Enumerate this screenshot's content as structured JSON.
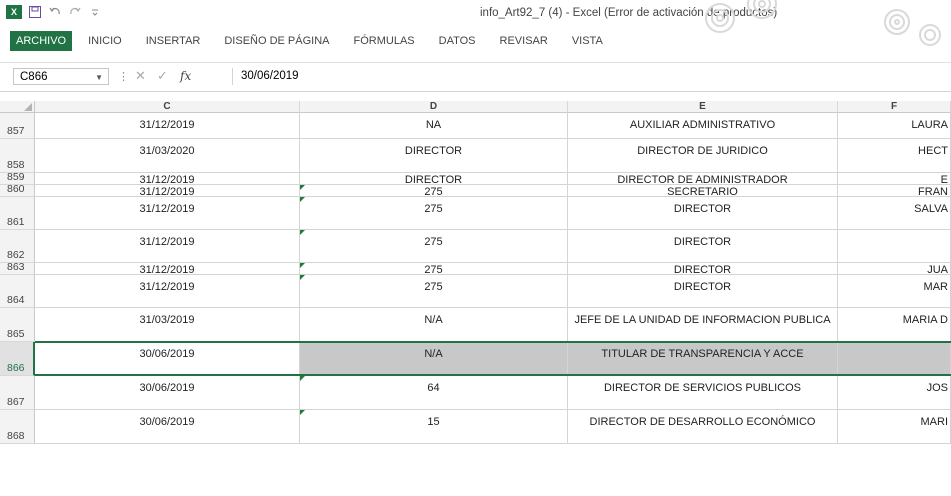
{
  "window": {
    "title": "info_Art92_7 (4) - Excel (Error de activación de productos)",
    "app_icon": "excel-logo-icon",
    "quick_access": [
      "save-icon",
      "undo-icon",
      "redo-icon",
      "customize-icon"
    ]
  },
  "ribbon": {
    "tabs": [
      "ARCHIVO",
      "INICIO",
      "INSERTAR",
      "DISEÑO DE PÁGINA",
      "FÓRMULAS",
      "DATOS",
      "REVISAR",
      "VISTA"
    ],
    "active_tab": "ARCHIVO"
  },
  "formula_bar": {
    "name_box": "C866",
    "fx_label": "fx",
    "value": "30/06/2019"
  },
  "grid": {
    "columns": [
      "C",
      "D",
      "E",
      "F"
    ],
    "rows": [
      {
        "num": "857",
        "c": "31/12/2019",
        "d": "NA",
        "e": "AUXILIAR ADMINISTRATIVO",
        "f": "LAURA"
      },
      {
        "num": "858",
        "c": "31/03/2020",
        "d": "DIRECTOR",
        "e": "DIRECTOR DE JURIDICO",
        "f": "HECT"
      },
      {
        "num": "859",
        "c": "31/12/2019",
        "d": "DIRECTOR",
        "e": "DIRECTOR DE ADMINISTRADOR",
        "f": "E"
      },
      {
        "num": "860",
        "c": "31/12/2019",
        "d": "275",
        "e": "SECRETARIO",
        "f": "FRAN"
      },
      {
        "num": "861",
        "c": "31/12/2019",
        "d": "275",
        "e": "DIRECTOR",
        "f": "SALVA"
      },
      {
        "num": "862",
        "c": "31/12/2019",
        "d": "275",
        "e": "DIRECTOR",
        "f": ""
      },
      {
        "num": "863",
        "c": "31/12/2019",
        "d": "275",
        "e": "DIRECTOR",
        "f": "JUA"
      },
      {
        "num": "864",
        "c": "31/12/2019",
        "d": "275",
        "e": "DIRECTOR",
        "f": "MAR"
      },
      {
        "num": "865",
        "c": "31/03/2019",
        "d": "N/A",
        "e": "JEFE DE LA UNIDAD DE INFORMACION PUBLICA",
        "f": "MARIA D"
      },
      {
        "num": "866",
        "c": "30/06/2019",
        "d": "N/A",
        "e": "TITULAR DE TRANSPARENCIA Y ACCE",
        "f": ""
      },
      {
        "num": "867",
        "c": "30/06/2019",
        "d": "64",
        "e": "DIRECTOR DE SERVICIOS PUBLICOS",
        "f": "JOS"
      },
      {
        "num": "868",
        "c": "30/06/2019",
        "d": "15",
        "e": "DIRECTOR DE DESARROLLO ECONÓMICO",
        "f": "MARI"
      }
    ]
  },
  "colors": {
    "excel_green": "#217346",
    "selected_fill": "#c8c8c8"
  }
}
